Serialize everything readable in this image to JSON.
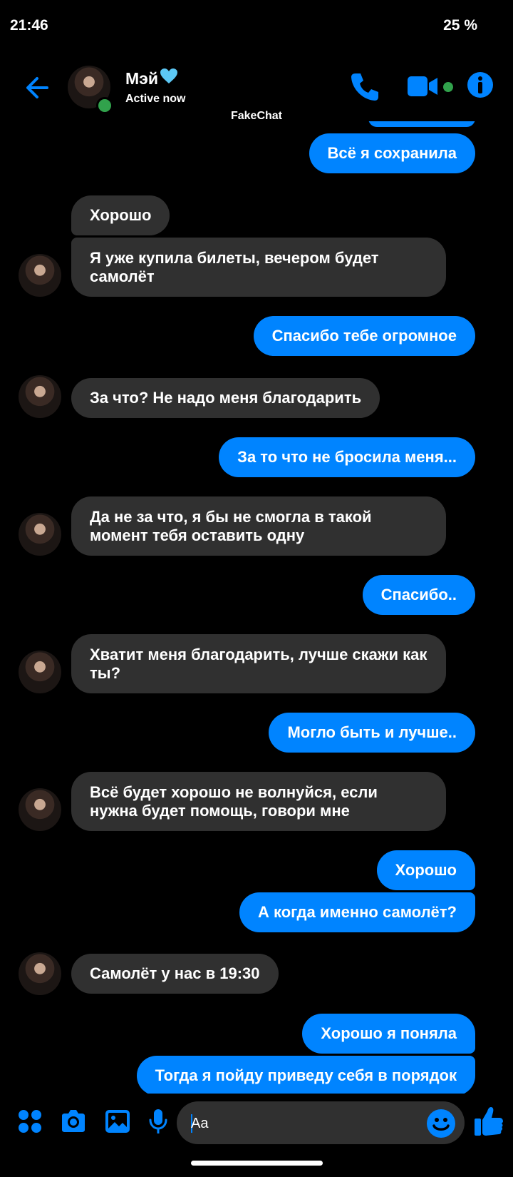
{
  "status_bar": {
    "time": "21:46",
    "battery": "25 %"
  },
  "header": {
    "contact_name": "Мэй",
    "contact_status": "Active now",
    "watermark": "FakeChat",
    "accent_color": "#0084ff",
    "online_color": "#31a24c",
    "icons": [
      "back-arrow-icon",
      "phone-icon",
      "video-camera-icon",
      "info-icon"
    ]
  },
  "messages": [
    {
      "dir": "out",
      "text": "Всё я сохранила"
    },
    {
      "dir": "in",
      "text": "Хорошо"
    },
    {
      "dir": "in",
      "text": "Я уже купила билеты, вечером будет самолёт"
    },
    {
      "dir": "out",
      "text": "Спасибо тебе огромное"
    },
    {
      "dir": "in",
      "text": "За что? Не надо меня благодарить"
    },
    {
      "dir": "out",
      "text": "За то что не бросила меня..."
    },
    {
      "dir": "in",
      "text": "Да не за что, я бы не смогла в такой момент тебя оставить одну"
    },
    {
      "dir": "out",
      "text": "Спасибо.."
    },
    {
      "dir": "in",
      "text": "Хватит меня благодарить, лучше скажи как ты?"
    },
    {
      "dir": "out",
      "text": "Могло быть и лучше.."
    },
    {
      "dir": "in",
      "text": "Всё будет хорошо не волнуйся, если нужна будет помощь, говори мне"
    },
    {
      "dir": "out",
      "text": "Хорошо"
    },
    {
      "dir": "out",
      "text": "А когда именно самолёт?"
    },
    {
      "dir": "in",
      "text": "Самолёт у нас в 19:30"
    },
    {
      "dir": "out",
      "text": "Хорошо я поняла"
    },
    {
      "dir": "out",
      "text": "Тогда я пойду приведу себя в порядок"
    }
  ],
  "composer": {
    "placeholder": "Aa",
    "icons": [
      "apps-grid-icon",
      "camera-icon",
      "gallery-icon",
      "microphone-icon",
      "emoji-icon",
      "thumbs-up-icon"
    ]
  },
  "colors": {
    "incoming_bubble": "#303030",
    "outgoing_bubble": "#0084ff",
    "background": "#000000"
  }
}
